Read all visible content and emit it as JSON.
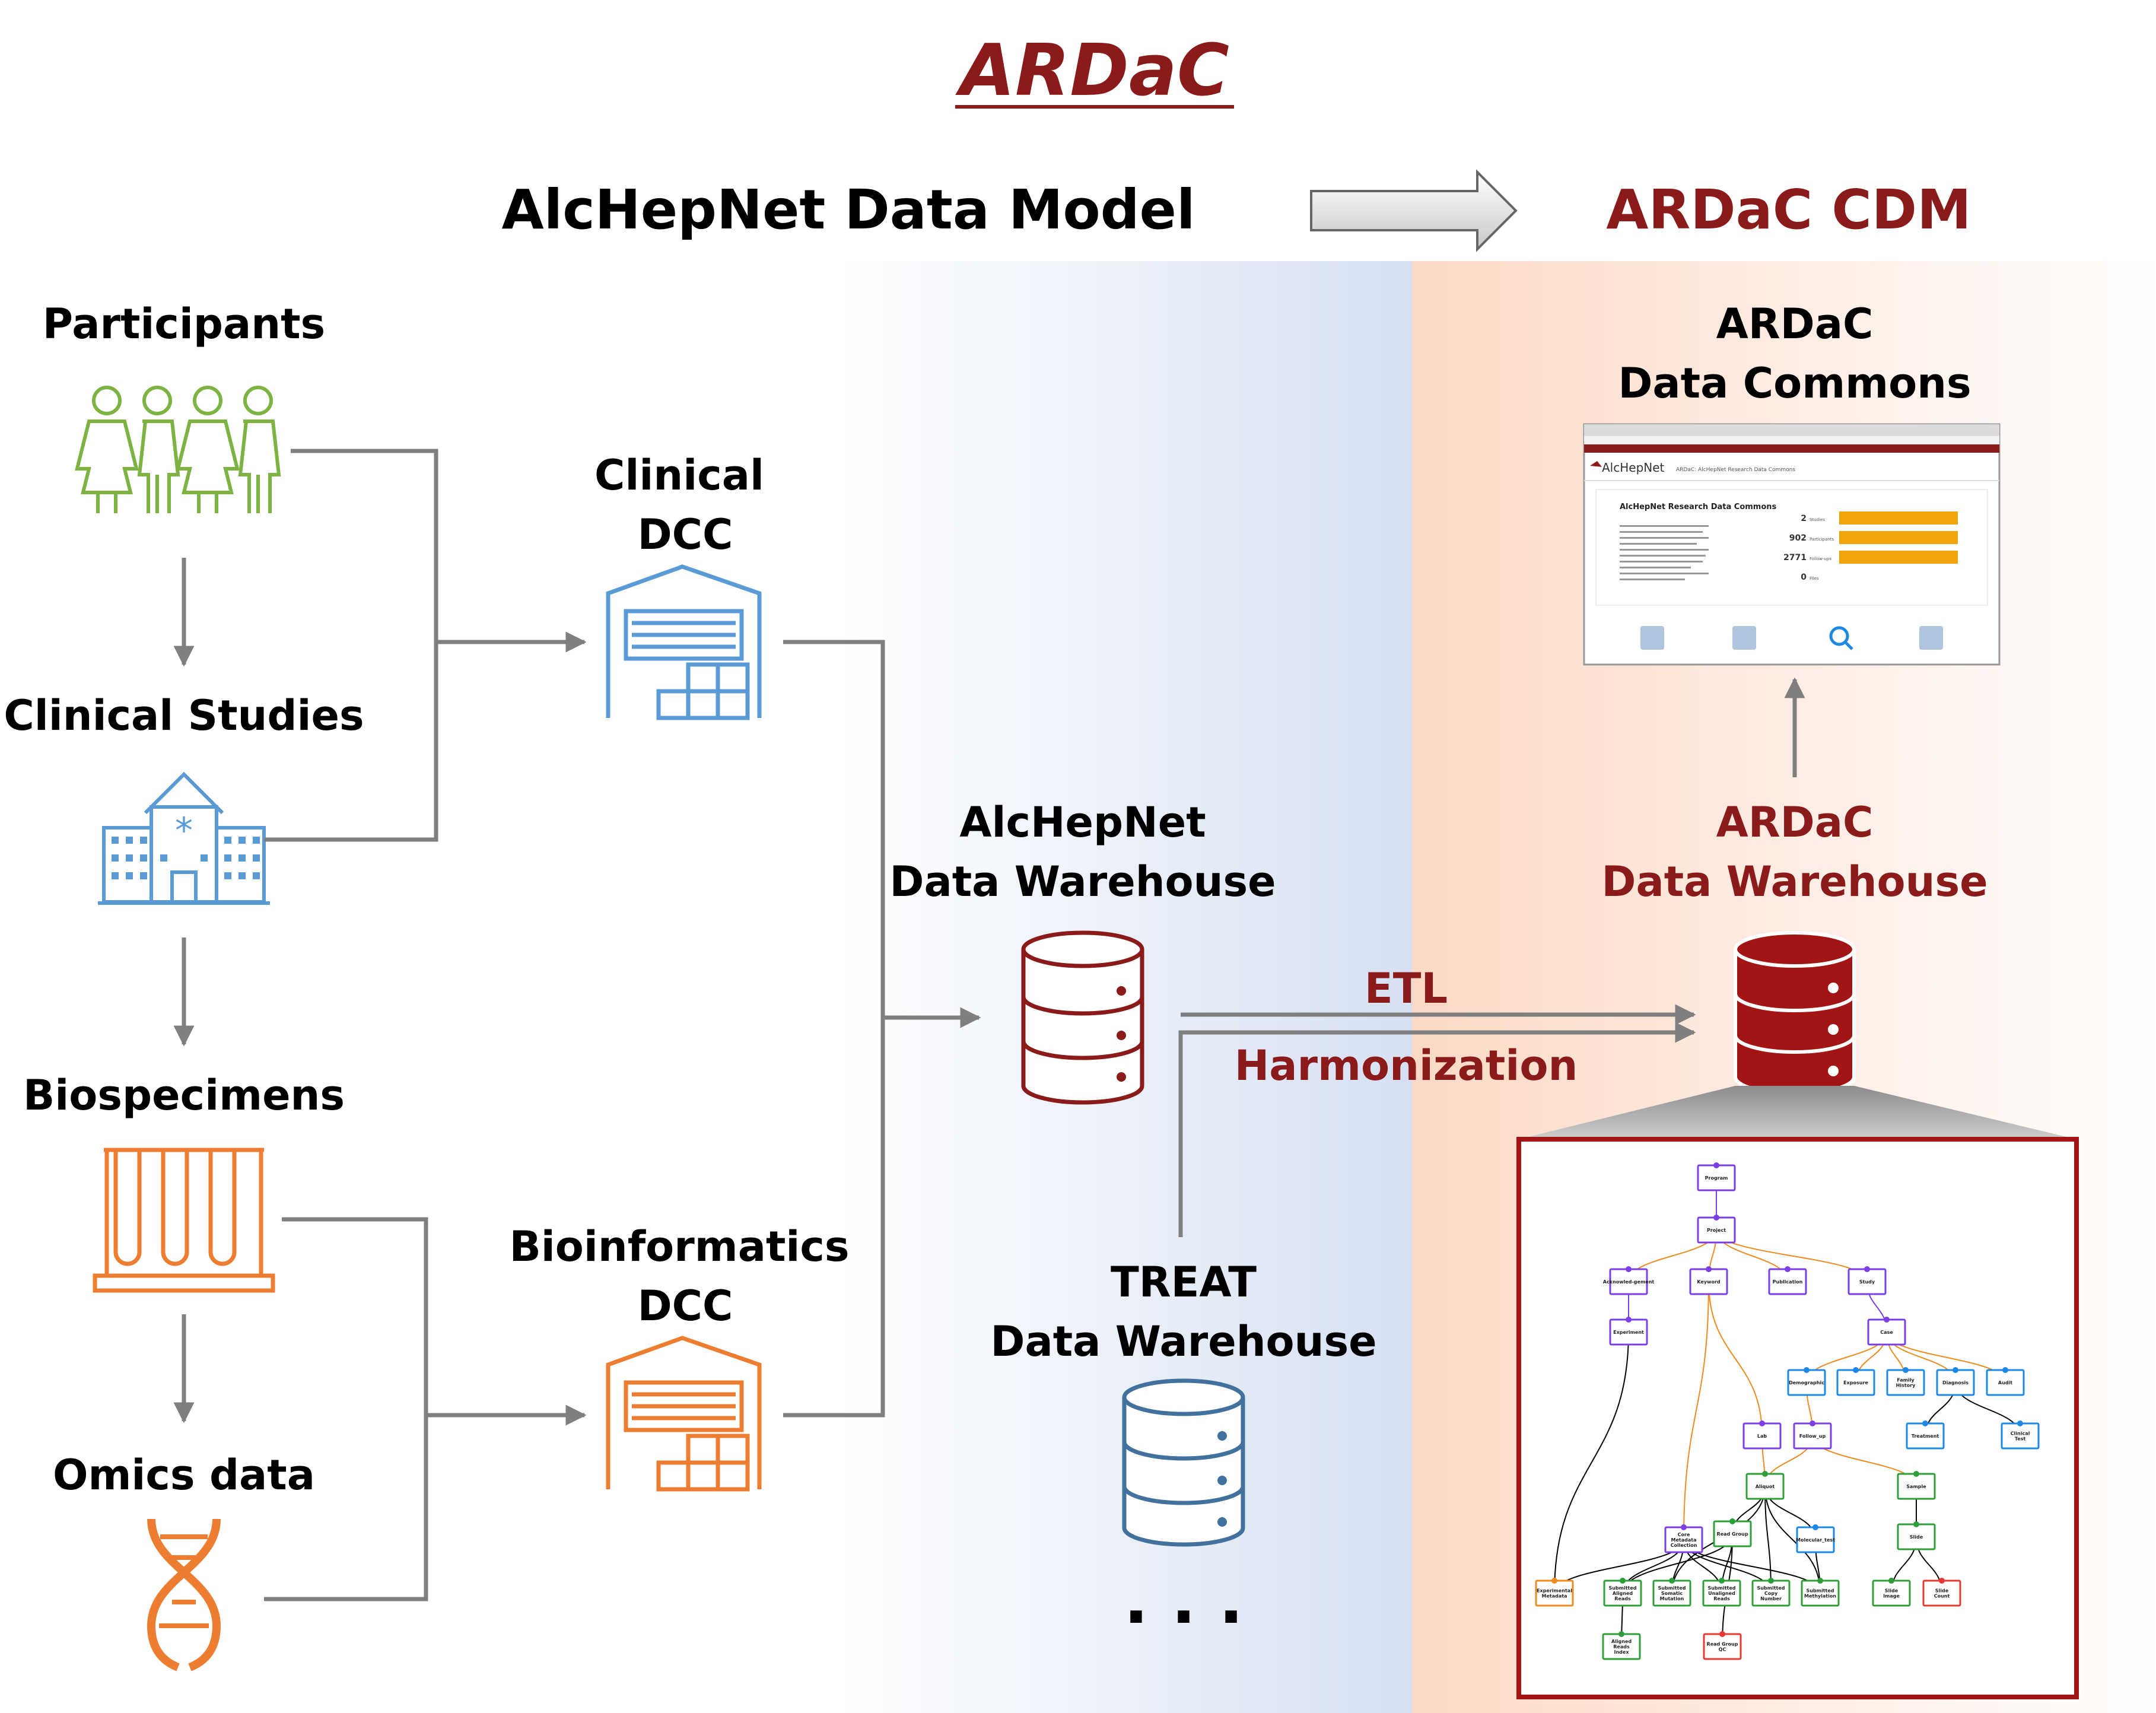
{
  "title": "ARDaC",
  "header": {
    "left": "AlcHepNet Data Model",
    "right": "ARDaC CDM"
  },
  "sources": {
    "participants": "Participants",
    "clinical_studies": "Clinical Studies",
    "biospecimens": "Biospecimens",
    "omics": "Omics data"
  },
  "dcc": {
    "clinical": [
      "Clinical",
      "DCC"
    ],
    "bioinformatics": [
      "Bioinformatics",
      "DCC"
    ]
  },
  "warehouses": {
    "alchepnet": [
      "AlcHepNet",
      "Data Warehouse"
    ],
    "treat": [
      "TREAT",
      "Data Warehouse"
    ],
    "more": ". . .",
    "ardac": [
      "ARDaC",
      "Data Warehouse"
    ]
  },
  "process": {
    "etl": "ETL",
    "harmonization": "Harmonization"
  },
  "commons": {
    "label": [
      "ARDaC",
      "Data Commons"
    ],
    "screenshot": {
      "site_name": "AlcHepNet",
      "site_subtitle": "ARDaC: AlcHepNet Research Data Commons",
      "card_title": "AlcHepNet Research Data Commons",
      "stats": [
        {
          "value": "2",
          "label": "Studies",
          "bar": 1.0
        },
        {
          "value": "902",
          "label": "Participants",
          "bar": 1.0
        },
        {
          "value": "2771",
          "label": "Follow-ups",
          "bar": 1.0
        },
        {
          "value": "0",
          "label": "Files",
          "bar": 0.0
        }
      ]
    }
  },
  "data_model": {
    "nodes": [
      {
        "id": "program",
        "label": "Program",
        "color": "#7b3fe4"
      },
      {
        "id": "project",
        "label": "Project",
        "color": "#7b3fe4"
      },
      {
        "id": "ack",
        "label": "Acknowled-gement",
        "color": "#7b3fe4"
      },
      {
        "id": "keyword",
        "label": "Keyword",
        "color": "#7b3fe4"
      },
      {
        "id": "publication",
        "label": "Publication",
        "color": "#7b3fe4"
      },
      {
        "id": "study",
        "label": "Study",
        "color": "#7b3fe4"
      },
      {
        "id": "experiment",
        "label": "Experiment",
        "color": "#7b3fe4"
      },
      {
        "id": "case",
        "label": "Case",
        "color": "#7b3fe4"
      },
      {
        "id": "demographic",
        "label": "Demographic",
        "color": "#1e88e5"
      },
      {
        "id": "exposure",
        "label": "Exposure",
        "color": "#1e88e5"
      },
      {
        "id": "family",
        "label": "Family History",
        "color": "#1e88e5"
      },
      {
        "id": "diagnosis",
        "label": "Diagnosis",
        "color": "#1e88e5"
      },
      {
        "id": "audit",
        "label": "Audit",
        "color": "#1e88e5"
      },
      {
        "id": "lab",
        "label": "Lab",
        "color": "#7b3fe4"
      },
      {
        "id": "followup",
        "label": "Follow_up",
        "color": "#7b3fe4"
      },
      {
        "id": "treatment",
        "label": "Treatment",
        "color": "#1e88e5"
      },
      {
        "id": "clinicaltest",
        "label": "Clinical Test",
        "color": "#1e88e5"
      },
      {
        "id": "aliquot",
        "label": "Aliquot",
        "color": "#2e9e3a"
      },
      {
        "id": "sample",
        "label": "Sample",
        "color": "#2e9e3a"
      },
      {
        "id": "core",
        "label": "Core Metadata Collection",
        "color": "#7b3fe4"
      },
      {
        "id": "readgroup",
        "label": "Read Group",
        "color": "#2e9e3a"
      },
      {
        "id": "molecular",
        "label": "Molecular_test",
        "color": "#1e88e5"
      },
      {
        "id": "slide",
        "label": "Slide",
        "color": "#2e9e3a"
      },
      {
        "id": "expmeta",
        "label": "Experimental Metadata",
        "color": "#ef8a1f"
      },
      {
        "id": "sar",
        "label": "Submitted Aligned Reads",
        "color": "#2e9e3a"
      },
      {
        "id": "ssm",
        "label": "Submitted Somatic Mutation",
        "color": "#2e9e3a"
      },
      {
        "id": "sur",
        "label": "Submitted Unaligned Reads",
        "color": "#2e9e3a"
      },
      {
        "id": "scn",
        "label": "Submitted Copy Number",
        "color": "#2e9e3a"
      },
      {
        "id": "smeth",
        "label": "Submitted Methylation",
        "color": "#2e9e3a"
      },
      {
        "id": "slideimage",
        "label": "Slide Image",
        "color": "#2e9e3a"
      },
      {
        "id": "slidecount",
        "label": "Slide Count",
        "color": "#e53935"
      },
      {
        "id": "ari",
        "label": "Aligned Reads Index",
        "color": "#2e9e3a"
      },
      {
        "id": "rgqc",
        "label": "Read Group QC",
        "color": "#e53935"
      }
    ]
  }
}
